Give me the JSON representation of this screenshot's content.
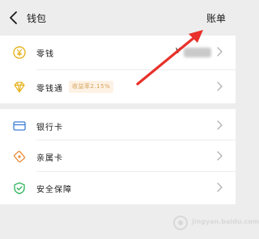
{
  "header": {
    "title": "钱包",
    "bill_link": "账单"
  },
  "wallet": {
    "change": {
      "label": "零钱",
      "currency_symbol": "¥"
    },
    "licaitong": {
      "label": "零钱通",
      "badge": "收益率2.15%"
    }
  },
  "cards": {
    "items": [
      {
        "label": "银行卡"
      },
      {
        "label": "亲属卡"
      },
      {
        "label": "安全保障"
      }
    ]
  },
  "watermark": {
    "text": "jingyan.baidu.com"
  },
  "colors": {
    "accent_yellow": "#e6b422",
    "accent_blue": "#3d7fd6",
    "accent_orange": "#e88b3c",
    "accent_green": "#2eb45b",
    "badge_bg": "#fdf2e4",
    "badge_text": "#d6a15a",
    "arrow_red": "#e8312a"
  }
}
